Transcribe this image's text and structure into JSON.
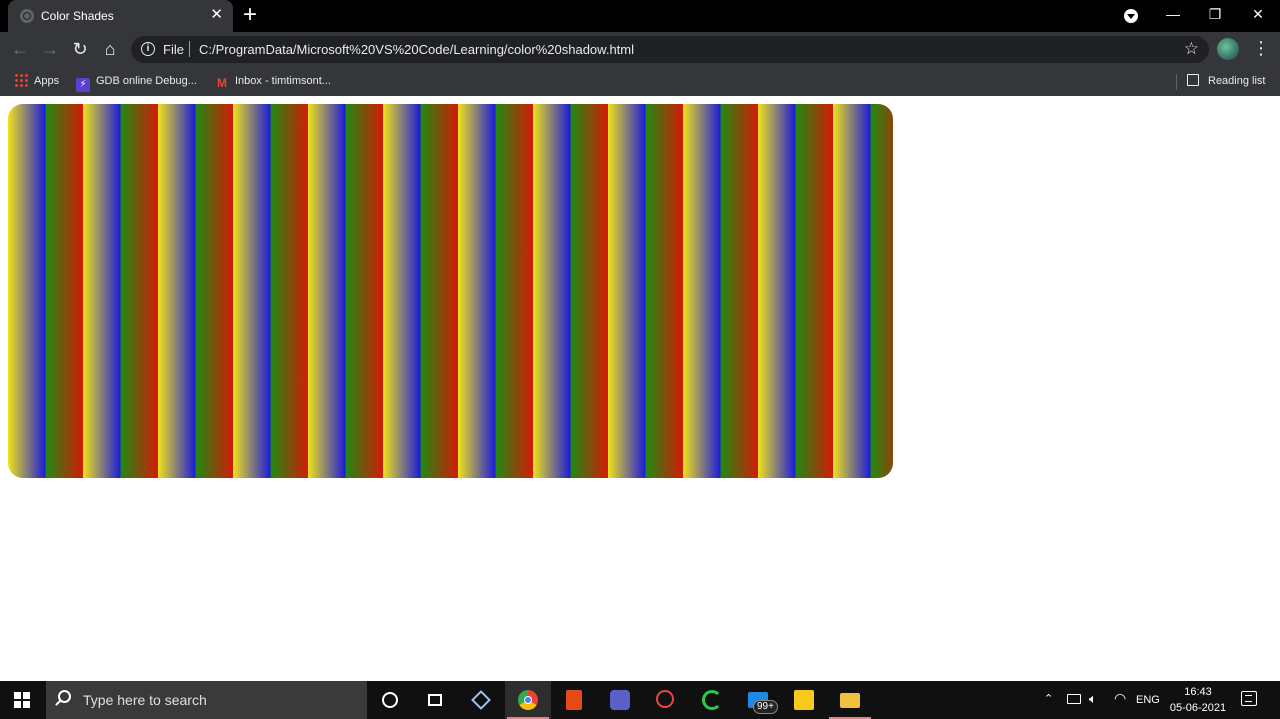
{
  "browser": {
    "tab_title": "Color Shades",
    "tab_close": "✕",
    "new_tab": "+",
    "window_controls": {
      "minimize": "—",
      "restore": "❐",
      "close": "✕"
    },
    "omnibox": {
      "scheme_label": "File",
      "url": "C:/ProgramData/Microsoft%20VS%20Code/Learning/color%20shadow.html"
    },
    "bookmarks": [
      {
        "label": "Apps",
        "icon": "apps-grid-icon"
      },
      {
        "label": "GDB online Debug...",
        "icon": "gdb-icon"
      },
      {
        "label": "Inbox - timtimsont...",
        "icon": "gmail-icon"
      }
    ],
    "reading_list": "Reading list"
  },
  "page": {
    "stripe_colors": [
      "#f0e21a",
      "#1a1adb",
      "#1f8a11",
      "#d41a05"
    ]
  },
  "taskbar": {
    "search_placeholder": "Type here to search",
    "apps": [
      "cortana-icon",
      "task-view-icon",
      "virtualbox-icon",
      "chrome-icon",
      "office-icon",
      "teams-icon",
      "spider-icon",
      "refresh-app-icon",
      "mail-icon",
      "sticky-notes-icon",
      "file-explorer-icon"
    ],
    "mail_badge": "99+",
    "language": "ENG",
    "time": "16:43",
    "date": "05-06-2021"
  }
}
